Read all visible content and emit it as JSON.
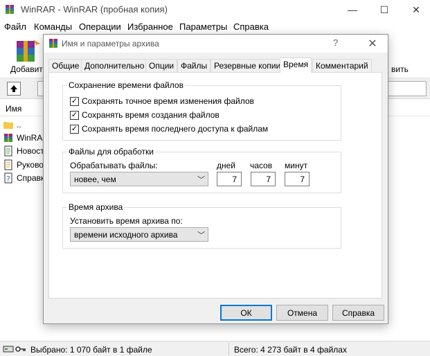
{
  "window": {
    "title": "WinRAR - WinRAR (пробная копия)",
    "minimize": "—",
    "maximize": "☐",
    "close": "✕"
  },
  "menu": [
    "Файл",
    "Команды",
    "Операции",
    "Избранное",
    "Параметры",
    "Справка"
  ],
  "toolbar": {
    "add_label": "Добавить",
    "right_label": "вить"
  },
  "filelist": {
    "column_name": "Имя",
    "rows": [
      "..",
      "WinRAR",
      "Новост",
      "Руково",
      "Справк"
    ]
  },
  "status": {
    "selected": "Выбрано: 1 070 байт в 1 файле",
    "total": "Всего: 4 273 байт в 4 файлах"
  },
  "dialog": {
    "title": "Имя и параметры архива",
    "help_glyph": "?",
    "close_glyph": "✕",
    "tabs": [
      "Общие",
      "Дополнительно",
      "Опции",
      "Файлы",
      "Резервные копии",
      "Время",
      "Комментарий"
    ],
    "active_tab": "Время",
    "group_save": {
      "title": "Сохранение времени файлов",
      "options": [
        {
          "label": "Сохранять точное время изменения файлов",
          "checked": true
        },
        {
          "label": "Сохранять время создания файлов",
          "checked": true
        },
        {
          "label": "Сохранять время последнего доступа к файлам",
          "checked": true
        }
      ]
    },
    "group_process": {
      "title": "Файлы для обработки",
      "process_label": "Обрабатывать файлы:",
      "process_value": "новее, чем",
      "days_label": "дней",
      "hours_label": "часов",
      "minutes_label": "минут",
      "days_value": "7",
      "hours_value": "7",
      "minutes_value": "7"
    },
    "group_archive": {
      "title": "Время архива",
      "set_label": "Установить время архива по:",
      "set_value": "времени исходного архива"
    },
    "buttons": {
      "ok": "ОК",
      "cancel": "Отмена",
      "help": "Справка"
    }
  },
  "colors": {
    "accent": "#0078d7",
    "dialog_bg": "#f0f0f0"
  }
}
